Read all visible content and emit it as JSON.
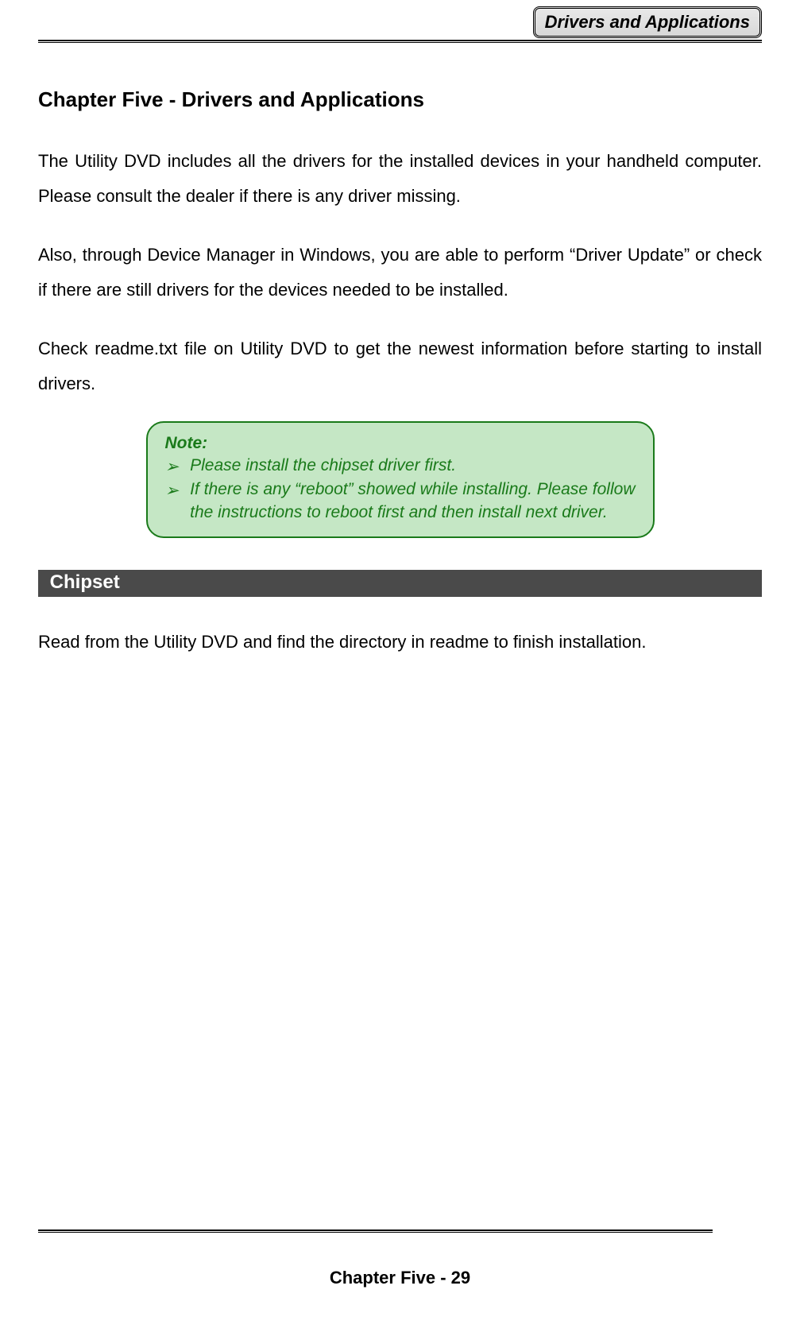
{
  "header": {
    "badge": "Drivers and Applications"
  },
  "chapter_title": "Chapter Five - Drivers and Applications",
  "paragraphs": {
    "p1": "The Utility DVD includes all the drivers for the installed devices in your handheld computer. Please consult the dealer if there is any driver missing.",
    "p2": "Also, through Device Manager in Windows, you are able to perform “Driver Update” or check if there are still drivers for the devices needed to be installed.",
    "p3": "Check readme.txt file on Utility DVD to get the newest information before starting to install drivers."
  },
  "note": {
    "label": "Note:",
    "items": [
      "Please install the chipset driver first.",
      "If there is any “reboot” showed while installing. Please follow the instructions to reboot first and then install next driver."
    ]
  },
  "section": {
    "chipset_heading": "Chipset",
    "chipset_body": "Read from the Utility DVD and find the directory in readme to finish installation."
  },
  "footer": "Chapter Five - 29",
  "glyphs": {
    "arrow": "➢"
  }
}
